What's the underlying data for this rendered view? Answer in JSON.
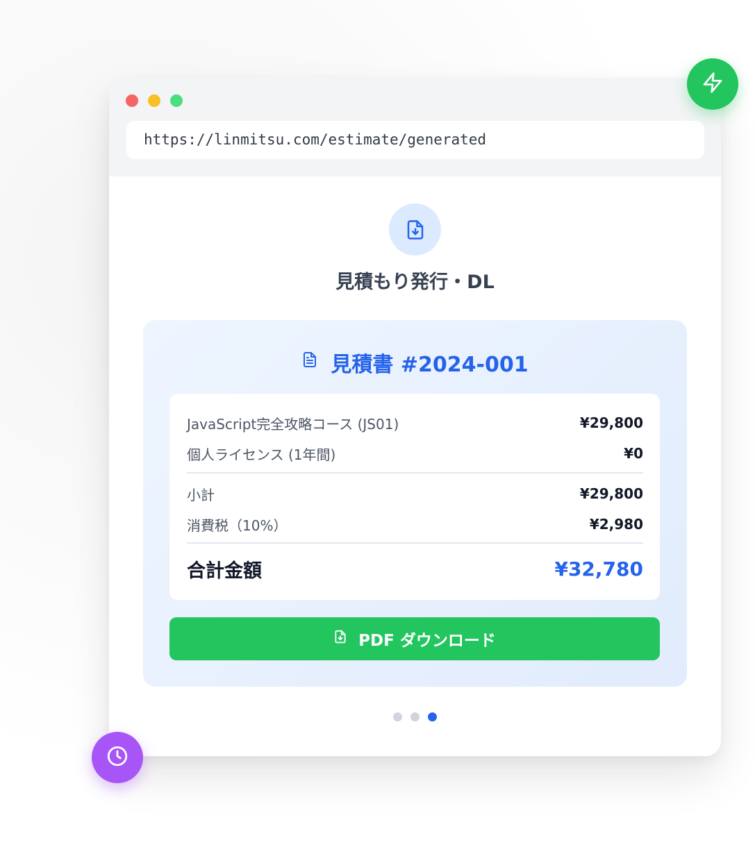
{
  "browser": {
    "url": "https://linmitsu.com/estimate/generated"
  },
  "step": {
    "title": "見積もり発行・DL",
    "icon": "file-download-icon"
  },
  "invoice": {
    "title": "見積書 #2024-001",
    "items": [
      {
        "label": "JavaScript完全攻略コース (JS01)",
        "value": "¥29,800"
      },
      {
        "label": "個人ライセンス (1年間)",
        "value": "¥0"
      }
    ],
    "subtotal": {
      "label": "小計",
      "value": "¥29,800"
    },
    "tax": {
      "label": "消費税（10%）",
      "value": "¥2,980"
    },
    "total": {
      "label": "合計金額",
      "value": "¥32,780"
    }
  },
  "download_button": {
    "label": "PDF ダウンロード",
    "icon": "file-download-icon"
  },
  "pager": {
    "count": 3,
    "active_index": 2
  },
  "floating": {
    "bolt_icon": "bolt-icon",
    "clock_icon": "clock-icon"
  },
  "colors": {
    "accent_blue": "#2563eb",
    "accent_green": "#22c55e",
    "accent_purple": "#a855f7"
  }
}
